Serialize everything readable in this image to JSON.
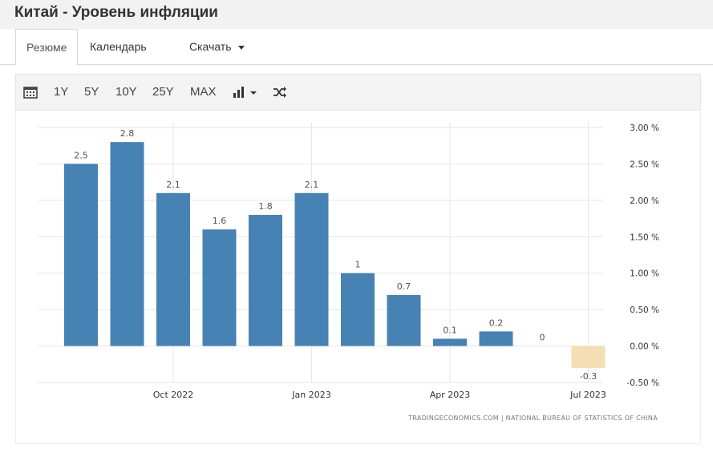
{
  "page": {
    "title": "Китай - Уровень инфляции"
  },
  "tabs": [
    {
      "label": "Резюме"
    },
    {
      "label": "Календарь"
    },
    {
      "label": "Скачать"
    }
  ],
  "toolbar": {
    "items": [
      "1Y",
      "5Y",
      "10Y",
      "25Y",
      "MAX"
    ],
    "icons": [
      "calendar-icon",
      "bar-chart-icon",
      "shuffle-icon"
    ]
  },
  "chart_data": {
    "type": "bar",
    "categories": [
      "2022-08",
      "2022-09",
      "2022-10",
      "2022-11",
      "2022-12",
      "2023-01",
      "2023-02",
      "2023-03",
      "2023-04",
      "2023-05",
      "2023-06",
      "2023-07"
    ],
    "values": [
      2.5,
      2.8,
      2.1,
      1.6,
      1.8,
      2.1,
      1.0,
      0.7,
      0.1,
      0.2,
      0,
      -0.3
    ],
    "data_labels": [
      "2.5",
      "2.8",
      "2.1",
      "1.6",
      "1.8",
      "2.1",
      "1",
      "0.7",
      "0.1",
      "0.2",
      "0",
      "-0.3"
    ],
    "x_tick_labels": [
      {
        "category": "2022-10",
        "label": "Oct 2022"
      },
      {
        "category": "2023-01",
        "label": "Jan 2023"
      },
      {
        "category": "2023-04",
        "label": "Apr 2023"
      },
      {
        "category": "2023-07",
        "label": "Jul 2023"
      }
    ],
    "y_tick_labels": [
      "3.00 %",
      "2.50 %",
      "2.00 %",
      "1.50 %",
      "1.00 %",
      "0.50 %",
      "0.00 %",
      "-0.50 %"
    ],
    "y_ticks": [
      3.0,
      2.5,
      2.0,
      1.5,
      1.0,
      0.5,
      0.0,
      -0.5
    ],
    "ylim": [
      -0.5,
      3.0
    ],
    "y_axis_position": "right",
    "grid": true,
    "colors": {
      "positive": "#4682b4",
      "negative": "#f5deb3"
    },
    "source": "TRADINGECONOMICS.COM | NATIONAL BUREAU OF STATISTICS OF CHINA"
  }
}
